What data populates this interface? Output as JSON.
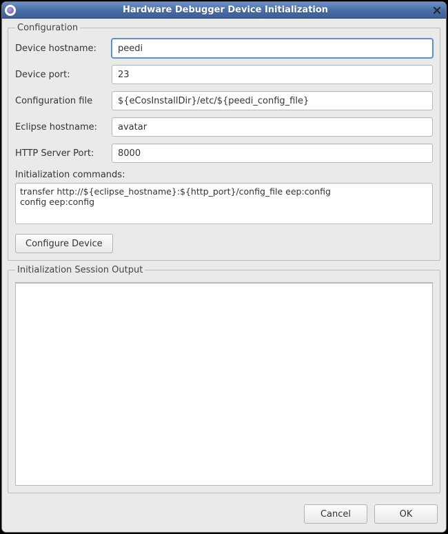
{
  "window": {
    "title": "Hardware Debugger Device Initialization"
  },
  "configuration": {
    "legend": "Configuration",
    "device_hostname": {
      "label": "Device hostname:",
      "value": "peedi"
    },
    "device_port": {
      "label": "Device port:",
      "value": "23"
    },
    "config_file": {
      "label": "Configuration file",
      "value": "${eCosInstallDir}/etc/${peedi_config_file}"
    },
    "eclipse_hostname": {
      "label": "Eclipse hostname:",
      "value": "avatar"
    },
    "http_port": {
      "label": "HTTP Server Port:",
      "value": "8000"
    },
    "init_cmds_label": "Initialization commands:",
    "init_cmds_value": "transfer http://${eclipse_hostname}:${http_port}/config_file eep:config\nconfig eep:config",
    "configure_button": "Configure Device"
  },
  "output": {
    "legend": "Initialization Session Output",
    "text": ""
  },
  "buttons": {
    "cancel": "Cancel",
    "ok": "OK"
  }
}
